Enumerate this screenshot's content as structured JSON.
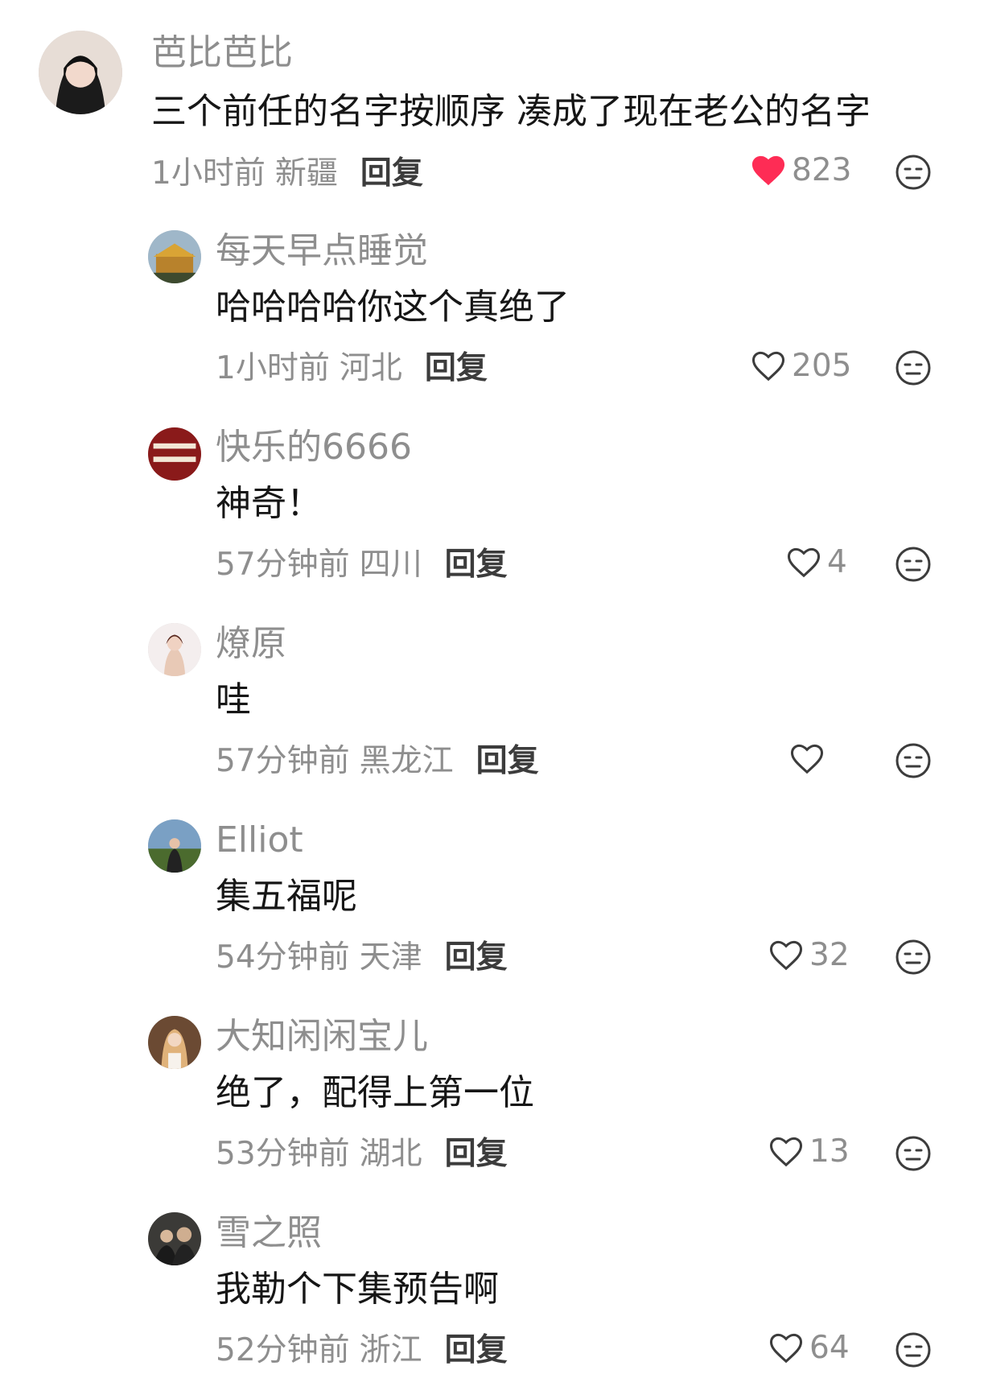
{
  "comments": [
    {
      "username": "芭比芭比",
      "text": "三个前任的名字按顺序 凑成了现在老公的名字",
      "time": "1小时前",
      "location": "新疆",
      "reply_label": "回复",
      "likes": "823",
      "liked": true,
      "like_color": "#fe2c55"
    },
    {
      "username": "每天早点睡觉",
      "text": "哈哈哈哈你这个真绝了",
      "time": "1小时前",
      "location": "河北",
      "reply_label": "回复",
      "likes": "205",
      "liked": false
    },
    {
      "username": "快乐的6666",
      "text": "神奇！",
      "time": "57分钟前",
      "location": "四川",
      "reply_label": "回复",
      "likes": "4",
      "liked": false
    },
    {
      "username": "燎原",
      "text": "哇",
      "time": "57分钟前",
      "location": "黑龙江",
      "reply_label": "回复",
      "likes": "",
      "liked": false
    },
    {
      "username": "Elliot",
      "text": "集五福呢",
      "time": "54分钟前",
      "location": "天津",
      "reply_label": "回复",
      "likes": "32",
      "liked": false
    },
    {
      "username": "大知闲闲宝儿",
      "text": "绝了，配得上第一位",
      "time": "53分钟前",
      "location": "湖北",
      "reply_label": "回复",
      "likes": "13",
      "liked": false
    },
    {
      "username": "雪之照",
      "text": "我勒个下集预告啊",
      "time": "52分钟前",
      "location": "浙江",
      "reply_label": "回复",
      "likes": "64",
      "liked": false
    }
  ],
  "icons": {
    "like": "heart-icon",
    "dislike": "dislike-face-icon"
  }
}
